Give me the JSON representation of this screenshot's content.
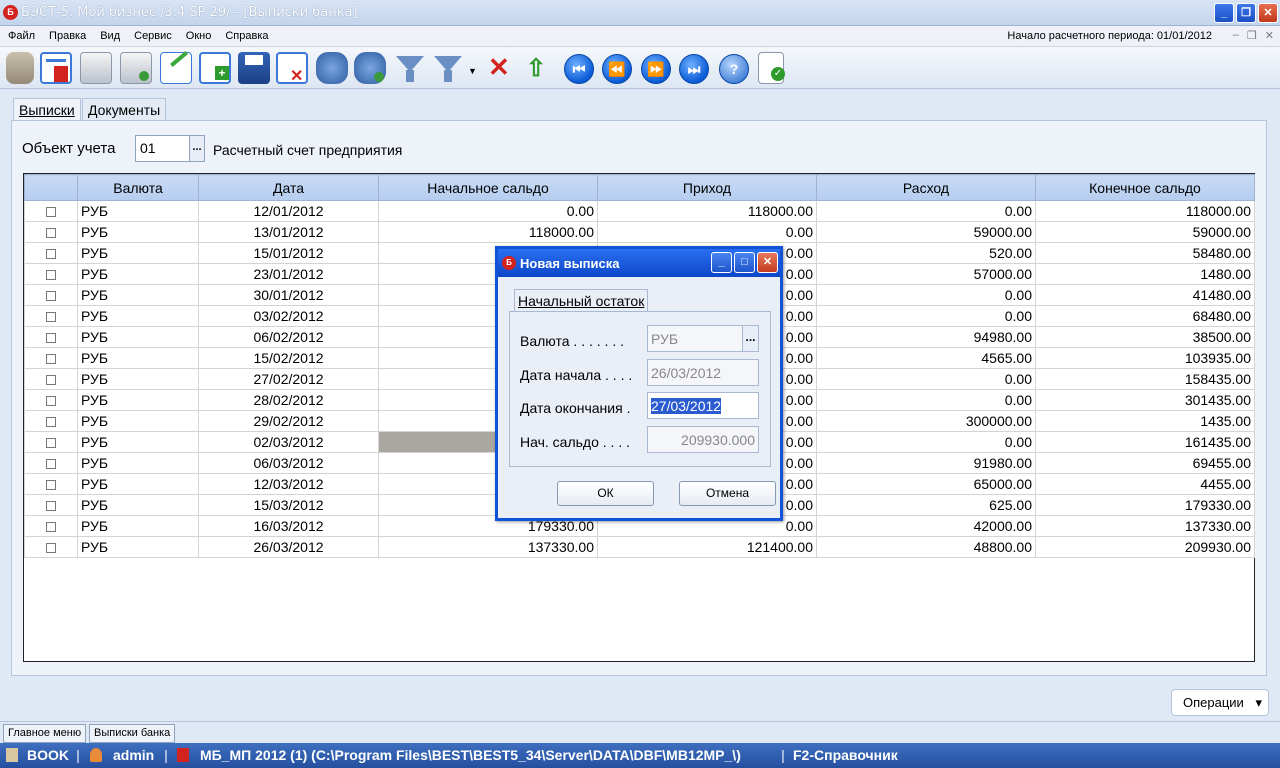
{
  "window": {
    "title": "БЭСТ-5. Мой бизнес /3.4 SP 29/ - [Выписки банка]",
    "app_icon": "Б"
  },
  "menu": {
    "items": [
      "Файл",
      "Правка",
      "Вид",
      "Сервис",
      "Окно",
      "Справка"
    ],
    "period": "Начало расчетного периода: 01/01/2012"
  },
  "toolbar": {
    "icons": [
      "disk-stack-icon",
      "statement-icon",
      "print-icon",
      "print-preview-icon",
      "edit-document-icon",
      "add-record-icon",
      "save-icon",
      "delete-record-icon",
      "find-icon",
      "find-next-icon",
      "filter-icon",
      "filter-menu-icon",
      "clear-filter-icon",
      "sort-icon",
      "first-record-icon",
      "previous-record-icon",
      "next-record-icon",
      "last-record-icon",
      "help-icon",
      "check-document-icon"
    ]
  },
  "tabs": [
    "Выписки",
    "Документы"
  ],
  "object": {
    "label": "Объект учета",
    "value": "01",
    "ellipsis": "...",
    "description": "Расчетный счет предприятия"
  },
  "table": {
    "columns": [
      "",
      "Валюта",
      "Дата",
      "Начальное сальдо",
      "Приход",
      "Расход",
      "Конечное сальдо"
    ],
    "rows": [
      {
        "currency": "РУБ",
        "date": "12/01/2012",
        "opening": "0.00",
        "income": "118000.00",
        "expense": "0.00",
        "closing": "118000.00"
      },
      {
        "currency": "РУБ",
        "date": "13/01/2012",
        "opening": "118000.00",
        "income": "0.00",
        "expense": "59000.00",
        "closing": "59000.00"
      },
      {
        "currency": "РУБ",
        "date": "15/01/2012",
        "opening": "",
        "income": "0.00",
        "expense": "520.00",
        "closing": "58480.00"
      },
      {
        "currency": "РУБ",
        "date": "23/01/2012",
        "opening": "",
        "income": "0.00",
        "expense": "57000.00",
        "closing": "1480.00"
      },
      {
        "currency": "РУБ",
        "date": "30/01/2012",
        "opening": "",
        "income": "0.00",
        "expense": "0.00",
        "closing": "41480.00"
      },
      {
        "currency": "РУБ",
        "date": "03/02/2012",
        "opening": "",
        "income": "0.00",
        "expense": "0.00",
        "closing": "68480.00"
      },
      {
        "currency": "РУБ",
        "date": "06/02/2012",
        "opening": "",
        "income": "0.00",
        "expense": "94980.00",
        "closing": "38500.00"
      },
      {
        "currency": "РУБ",
        "date": "15/02/2012",
        "opening": "",
        "income": "0.00",
        "expense": "4565.00",
        "closing": "103935.00"
      },
      {
        "currency": "РУБ",
        "date": "27/02/2012",
        "opening": "",
        "income": "0.00",
        "expense": "0.00",
        "closing": "158435.00"
      },
      {
        "currency": "РУБ",
        "date": "28/02/2012",
        "opening": "",
        "income": "0.00",
        "expense": "0.00",
        "closing": "301435.00"
      },
      {
        "currency": "РУБ",
        "date": "29/02/2012",
        "opening": "",
        "income": "0.00",
        "expense": "300000.00",
        "closing": "1435.00"
      },
      {
        "currency": "РУБ",
        "date": "02/03/2012",
        "opening": "",
        "income": "0.00",
        "expense": "0.00",
        "closing": "161435.00"
      },
      {
        "currency": "РУБ",
        "date": "06/03/2012",
        "opening": "",
        "income": "0.00",
        "expense": "91980.00",
        "closing": "69455.00"
      },
      {
        "currency": "РУБ",
        "date": "12/03/2012",
        "opening": "",
        "income": "0.00",
        "expense": "65000.00",
        "closing": "4455.00"
      },
      {
        "currency": "РУБ",
        "date": "15/03/2012",
        "opening": "",
        "income": "0.00",
        "expense": "625.00",
        "closing": "179330.00"
      },
      {
        "currency": "РУБ",
        "date": "16/03/2012",
        "opening": "179330.00",
        "income": "0.00",
        "expense": "42000.00",
        "closing": "137330.00"
      },
      {
        "currency": "РУБ",
        "date": "26/03/2012",
        "opening": "137330.00",
        "income": "121400.00",
        "expense": "48800.00",
        "closing": "209930.00"
      }
    ]
  },
  "dialog": {
    "title": "Новая выписка",
    "tab": "Начальный остаток",
    "currency_label": "Валюта . . . . . . .",
    "currency_value": "РУБ",
    "ellipsis": "...",
    "start_label": "Дата начала . . . .",
    "start_value": "26/03/2012",
    "end_label": "Дата окончания .",
    "end_value": "27/03/2012",
    "balance_label": "Нач. сальдо . . . .",
    "balance_value": "209930.000",
    "ok": "ОК",
    "cancel": "Отмена"
  },
  "operations": {
    "label": "Операции",
    "arrow": "▾"
  },
  "taskbar": [
    "Главное меню",
    "Выписки банка"
  ],
  "status": {
    "db": "BOOK",
    "user": "admin",
    "path": "МБ_МП 2012 (1) (C:\\Program Files\\BEST\\BEST5_34\\Server\\DATA\\DBF\\MB12MP_\\)",
    "hint": "F2-Справочник"
  }
}
